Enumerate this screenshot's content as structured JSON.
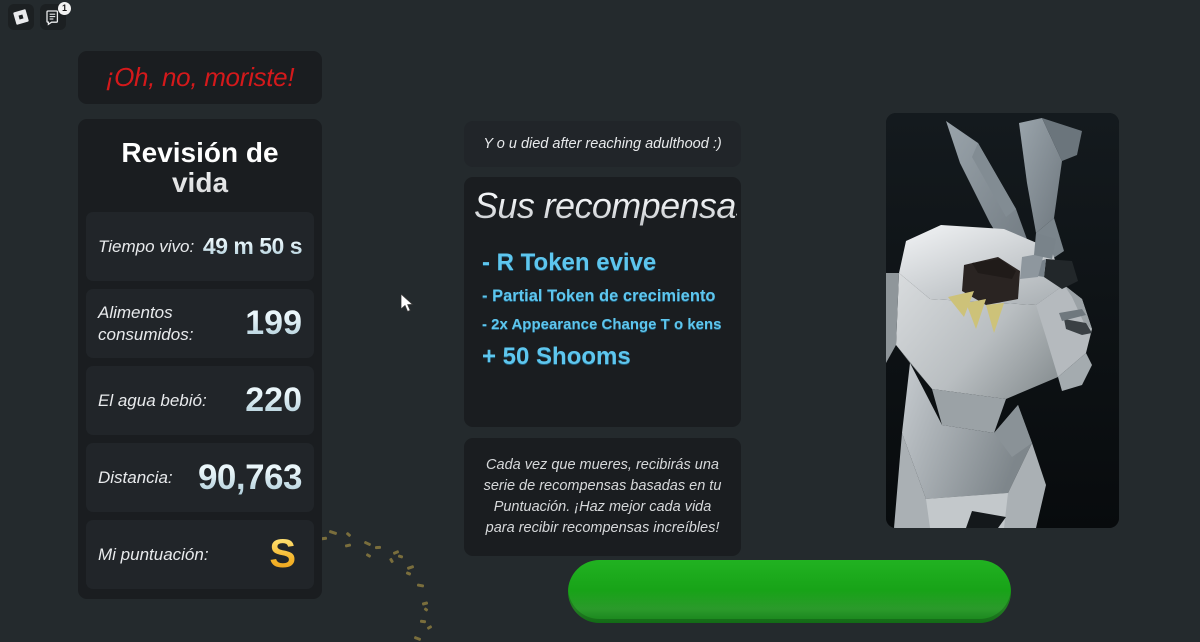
{
  "topbar": {
    "roblox_icon": "roblox-logo-icon",
    "chat_icon": "chat-document-icon",
    "notification_count": "1"
  },
  "left": {
    "death_banner": "¡Oh, no, moriste!",
    "review_title": "Revisión de vida",
    "stats": [
      {
        "label": "Tiempo vivo:",
        "value": "49 m 50 s"
      },
      {
        "label": "Alimentos consumidos:",
        "value": "199"
      },
      {
        "label": "El agua bebió:",
        "value": "220"
      },
      {
        "label": "Distancia:",
        "value": "90,763"
      },
      {
        "label": "Mi puntuación:",
        "value": "S"
      }
    ]
  },
  "middle": {
    "died_note": "Y o u died after reaching adulthood :)",
    "rewards_title": "Sus recompensas:",
    "rewards": [
      "-  R Token evive",
      "- Partial Token de crecimiento",
      "- 2x Appearance Change T o kens",
      "+ 50 Shooms"
    ],
    "info_text": "Cada vez que mueres, recibirás una serie de recompensas basadas en tu Puntuación. ¡Haz mejor cada vida para recibir recompensas increíbles!"
  },
  "actions": {
    "continue_button": ""
  },
  "portrait": {
    "name": "rabbit-avatar-portrait"
  },
  "colors": {
    "background": "#242a2d",
    "panel": "#1a1d20",
    "row": "#212529",
    "death_red": "#d4191b",
    "reward_blue": "#5ec6ee",
    "score_gold": "#f5b52a",
    "button_green": "#18a318",
    "value_light": "#eaf6fa"
  }
}
